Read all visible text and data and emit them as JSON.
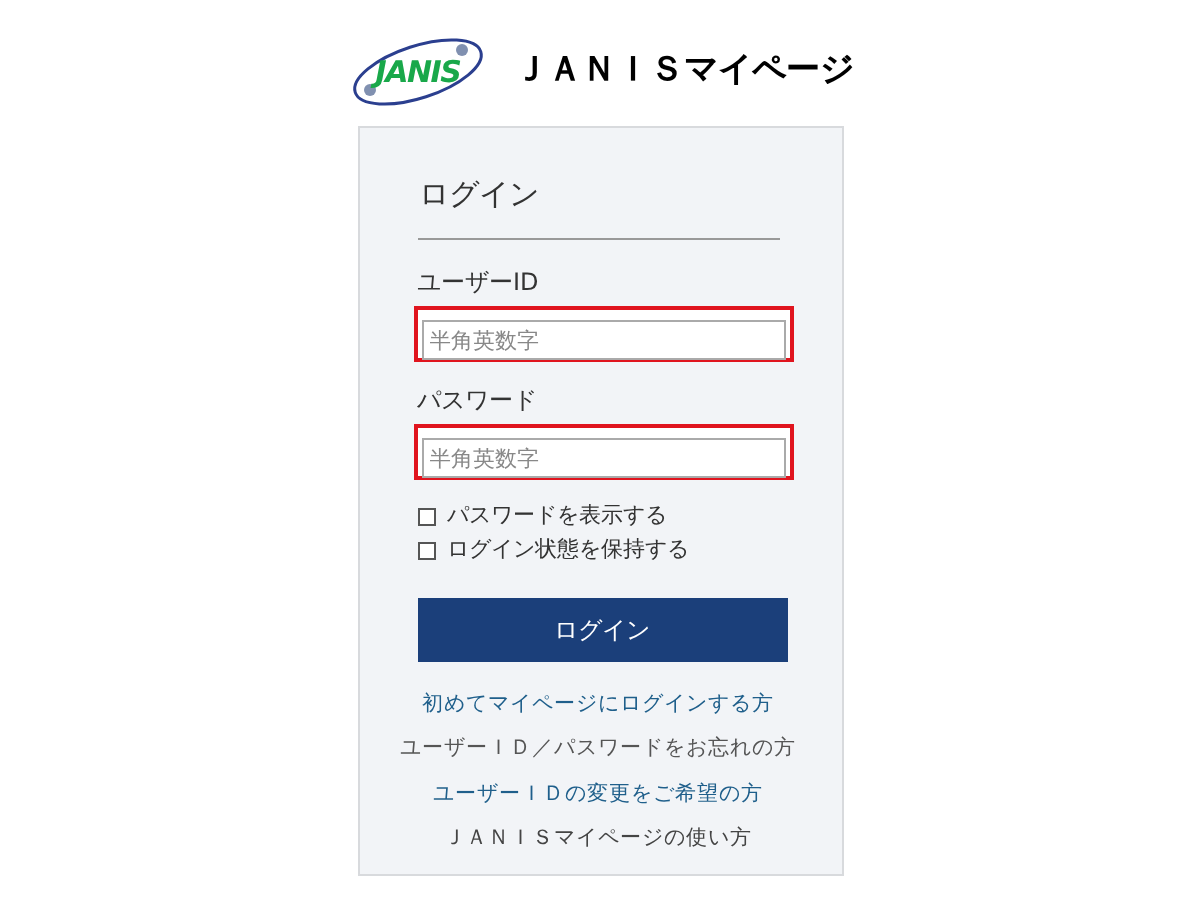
{
  "header": {
    "logo_text": "JANIS",
    "title": "ＪＡＮＩＳマイページ"
  },
  "login": {
    "heading": "ログイン",
    "fields": [
      {
        "label": "ユーザーID",
        "placeholder": "半角英数字",
        "highlighted": true
      },
      {
        "label": "パスワード",
        "placeholder": "半角英数字",
        "highlighted": true
      }
    ],
    "checkboxes": [
      {
        "label": "パスワードを表示する",
        "checked": false
      },
      {
        "label": "ログイン状態を保持する",
        "checked": false
      }
    ],
    "button": "ログイン",
    "links": [
      {
        "text": "初めてマイページにログインする方",
        "color": "#1f5f8b"
      },
      {
        "text": "ユーザーＩＤ／パスワードをお忘れの方",
        "color": "#555555"
      },
      {
        "text": "ユーザーＩＤの変更をご希望の方",
        "color": "#1f5f8b"
      },
      {
        "text": "ＪＡＮＩＳマイページの使い方",
        "color": "#444444"
      }
    ]
  }
}
